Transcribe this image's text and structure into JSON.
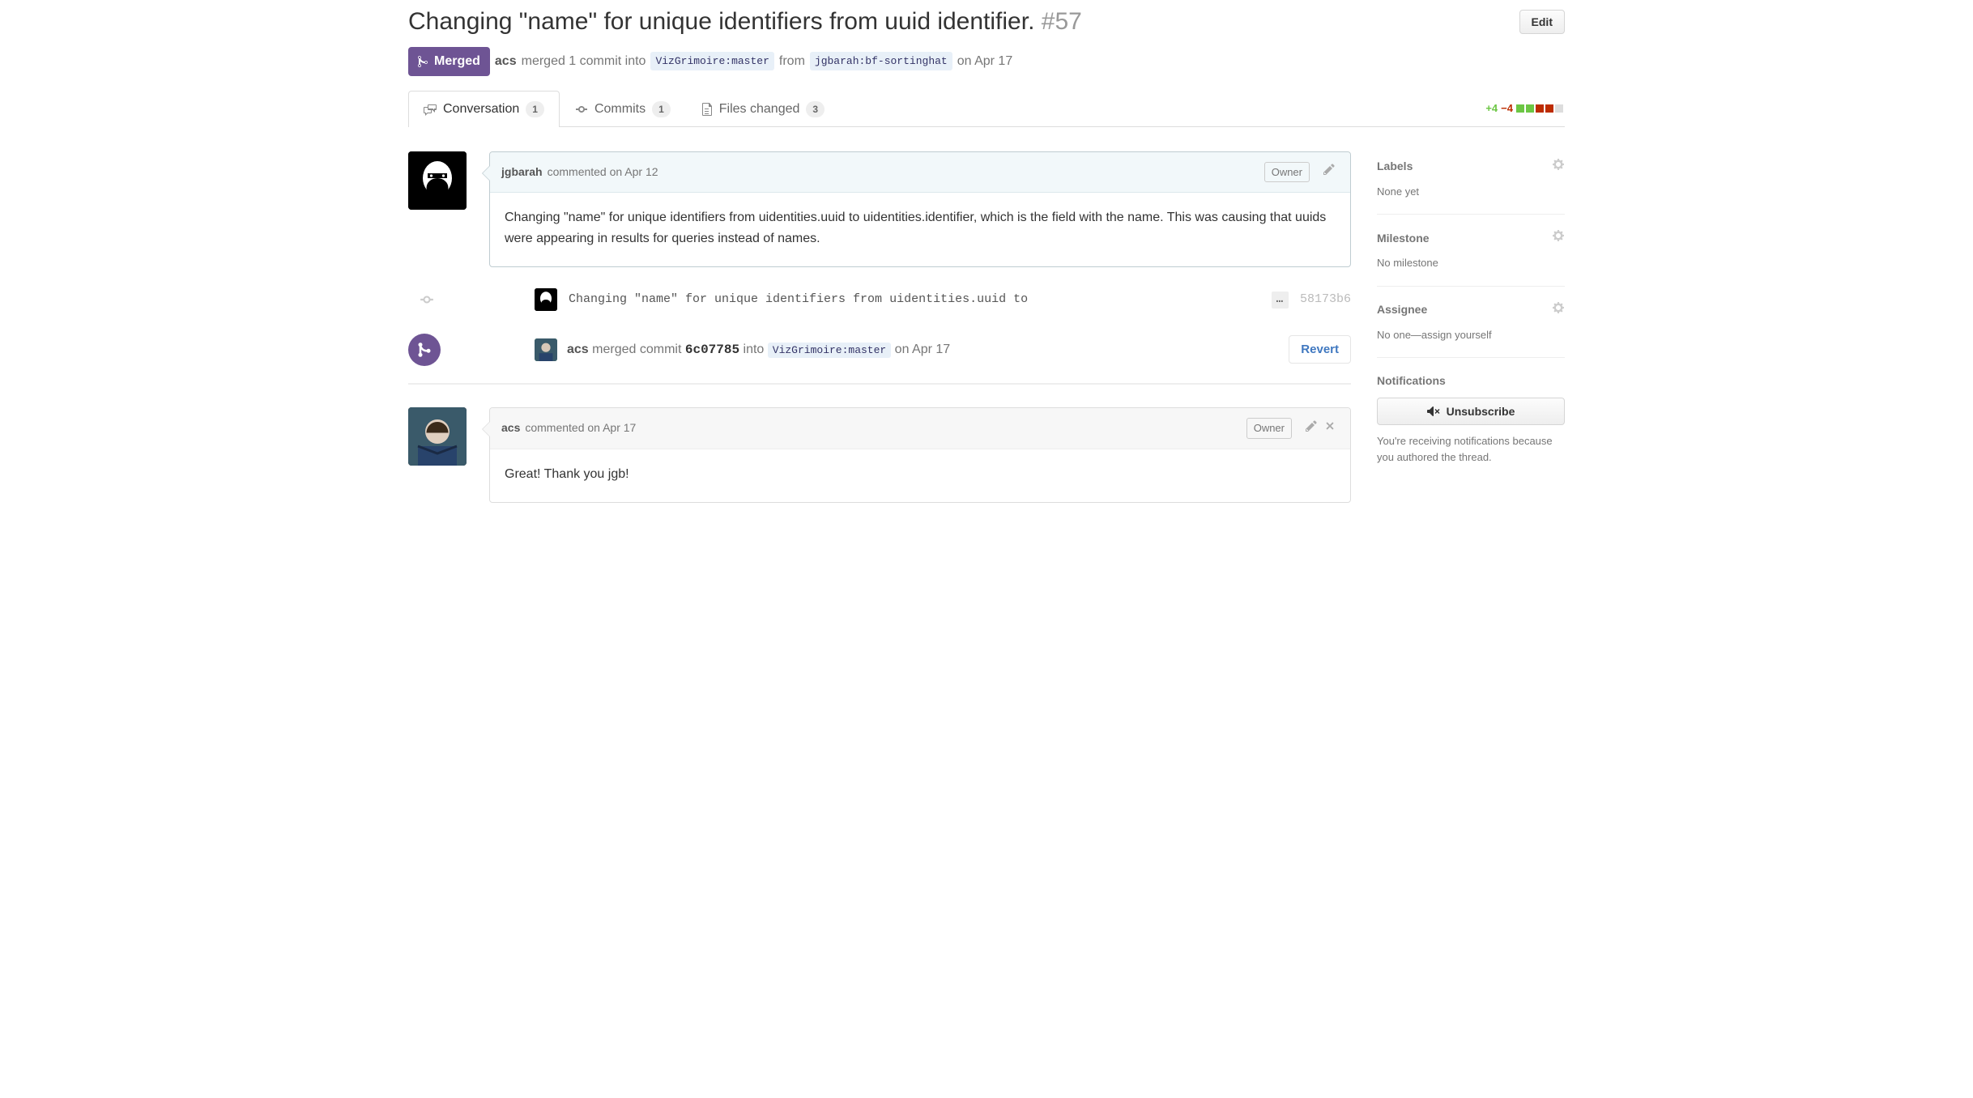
{
  "title": "Changing \"name\" for unique identifiers from uuid identifier.",
  "issue_number": "#57",
  "edit_label": "Edit",
  "state": "Merged",
  "merge_line": {
    "actor": "acs",
    "prefix": "merged 1 commit into",
    "base_ref": "VizGrimoire:master",
    "middle": "from",
    "head_ref": "jgbarah:bf-sortinghat",
    "when": "on Apr 17"
  },
  "tabs": {
    "conversation": {
      "label": "Conversation",
      "count": "1"
    },
    "commits": {
      "label": "Commits",
      "count": "1"
    },
    "files": {
      "label": "Files changed",
      "count": "3"
    }
  },
  "diffstat": {
    "add": "+4",
    "del": "−4"
  },
  "comment1": {
    "author": "jgbarah",
    "when": "commented on Apr 12",
    "owner_badge": "Owner",
    "body": "Changing \"name\" for unique identifiers from uidentities.uuid to uidentities.identifier, which is the field with the name. This was causing that uuids were appearing in results for queries instead of names."
  },
  "commit": {
    "message": "Changing \"name\" for unique identifiers from uidentities.uuid to",
    "ellipsis": "…",
    "sha": "58173b6"
  },
  "merge_event": {
    "actor": "acs",
    "prefix": "merged commit",
    "sha": "6c07785",
    "into": "into",
    "base_ref": "VizGrimoire:master",
    "when": "on Apr 17",
    "revert": "Revert"
  },
  "comment2": {
    "author": "acs",
    "when": "commented on Apr 17",
    "owner_badge": "Owner",
    "body": "Great! Thank you jgb!"
  },
  "sidebar": {
    "labels": {
      "title": "Labels",
      "value": "None yet"
    },
    "milestone": {
      "title": "Milestone",
      "value": "No milestone"
    },
    "assignee": {
      "title": "Assignee",
      "value": "No one—assign yourself"
    },
    "notifications": {
      "title": "Notifications",
      "button": "Unsubscribe",
      "note": "You're receiving notifications because you authored the thread."
    }
  }
}
